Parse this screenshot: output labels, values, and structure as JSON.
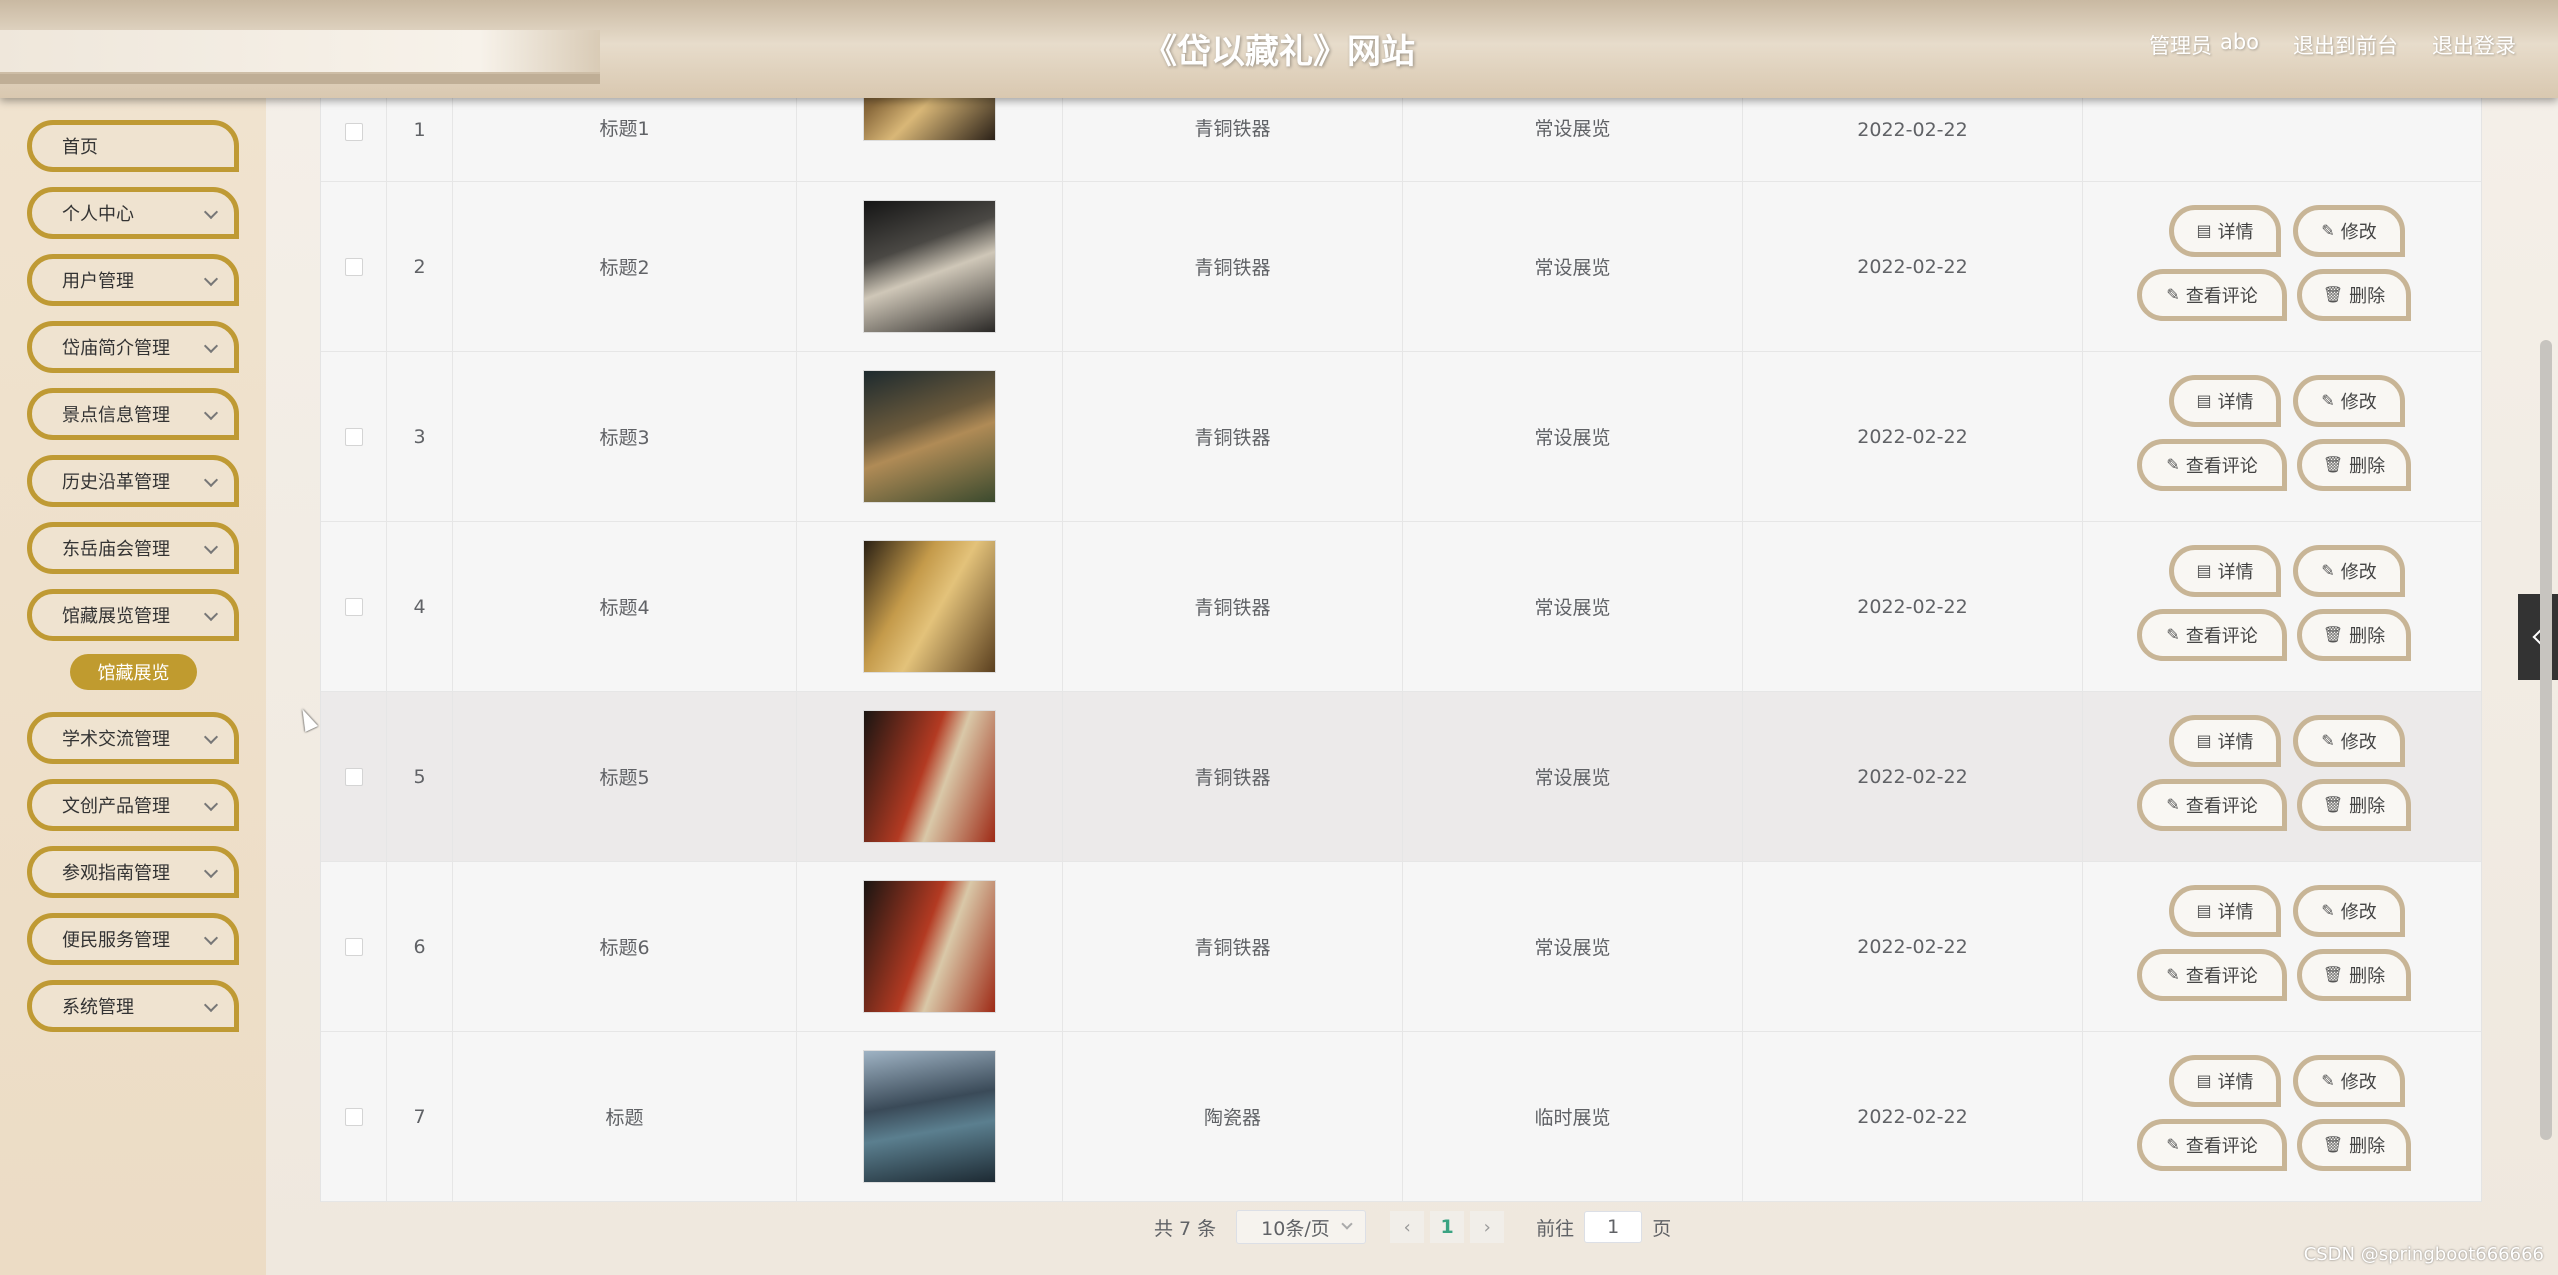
{
  "header": {
    "title": "《岱以藏礼》网站",
    "user_role": "管理员",
    "user_name": "abo",
    "link_front": "退出到前台",
    "link_logout": "退出登录"
  },
  "sidebar": {
    "items": [
      {
        "label": "首页",
        "has_children": false
      },
      {
        "label": "个人中心",
        "has_children": true
      },
      {
        "label": "用户管理",
        "has_children": true
      },
      {
        "label": "岱庙简介管理",
        "has_children": true
      },
      {
        "label": "景点信息管理",
        "has_children": true
      },
      {
        "label": "历史沿革管理",
        "has_children": true
      },
      {
        "label": "东岳庙会管理",
        "has_children": true
      },
      {
        "label": "馆藏展览管理",
        "has_children": true
      },
      {
        "label": "学术交流管理",
        "has_children": true
      },
      {
        "label": "文创产品管理",
        "has_children": true
      },
      {
        "label": "参观指南管理",
        "has_children": true
      },
      {
        "label": "便民服务管理",
        "has_children": true
      },
      {
        "label": "系统管理",
        "has_children": true
      }
    ],
    "active_submenu": "馆藏展览"
  },
  "table": {
    "rows": [
      {
        "index": "1",
        "title": "标题1",
        "category": "青铜铁器",
        "type": "常设展览",
        "date": "2022-02-22"
      },
      {
        "index": "2",
        "title": "标题2",
        "category": "青铜铁器",
        "type": "常设展览",
        "date": "2022-02-22"
      },
      {
        "index": "3",
        "title": "标题3",
        "category": "青铜铁器",
        "type": "常设展览",
        "date": "2022-02-22"
      },
      {
        "index": "4",
        "title": "标题4",
        "category": "青铜铁器",
        "type": "常设展览",
        "date": "2022-02-22"
      },
      {
        "index": "5",
        "title": "标题5",
        "category": "青铜铁器",
        "type": "常设展览",
        "date": "2022-02-22"
      },
      {
        "index": "6",
        "title": "标题6",
        "category": "青铜铁器",
        "type": "常设展览",
        "date": "2022-02-22"
      },
      {
        "index": "7",
        "title": "标题",
        "category": "陶瓷器",
        "type": "临时展览",
        "date": "2022-02-22"
      }
    ],
    "actions": {
      "detail": "详情",
      "edit": "修改",
      "comments": "查看评论",
      "delete": "删除"
    }
  },
  "pagination": {
    "total": "共 7 条",
    "page_size": "10条/页",
    "current_page": "1",
    "goto_label": "前往",
    "goto_value": "1",
    "page_suffix": "页"
  },
  "watermark": "CSDN @springboot666666",
  "colors": {
    "accent_gold": "#bf9a34",
    "button_border": "#c8b596",
    "active_page": "#3aa382"
  }
}
